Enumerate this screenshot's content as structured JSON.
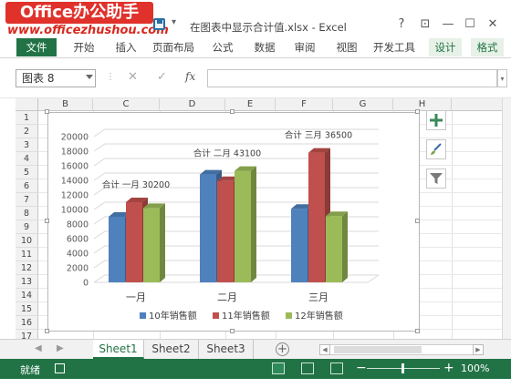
{
  "logo": {
    "brand": "Office办公助手",
    "url": "www.officezhushou.com"
  },
  "window": {
    "title": "在图表中显示合计值.xlsx - Excel",
    "help": "?",
    "restore_ribbon": "⊡",
    "minimize": "—",
    "maximize": "☐",
    "close": "✕"
  },
  "ribbon": {
    "tabs": [
      "文件",
      "开始",
      "插入",
      "页面布局",
      "公式",
      "数据",
      "审阅",
      "视图",
      "开发工具",
      "设计",
      "格式"
    ]
  },
  "formula_bar": {
    "name_box": "图表 8",
    "fx": "fx",
    "value": ""
  },
  "grid": {
    "columns": [
      "B",
      "C",
      "D",
      "E",
      "F",
      "G",
      "H"
    ],
    "rows": [
      "1",
      "2",
      "3",
      "4",
      "5",
      "6",
      "7",
      "8",
      "9",
      "10",
      "11",
      "12",
      "13",
      "14",
      "15",
      "16",
      "17"
    ]
  },
  "chart_data": {
    "type": "bar",
    "style": "3d-clustered-column",
    "categories": [
      "一月",
      "二月",
      "三月"
    ],
    "series": [
      {
        "name": "10年销售额",
        "color": "#4f81bd",
        "values": [
          9000,
          14800,
          10100
        ]
      },
      {
        "name": "11年销售额",
        "color": "#c0504d",
        "values": [
          11000,
          13900,
          17800
        ]
      },
      {
        "name": "12年销售额",
        "color": "#9bbb59",
        "values": [
          10200,
          15300,
          9100
        ]
      }
    ],
    "yticks": [
      "20000",
      "18000",
      "16000",
      "14000",
      "12000",
      "10000",
      "8000",
      "6000",
      "4000",
      "2000",
      "0"
    ],
    "ylim": [
      0,
      20000
    ],
    "grid": true,
    "legend": "bottom",
    "annotations": [
      "合计 一月 30200",
      "合计 二月 43100",
      "合计 三月 36500"
    ]
  },
  "chart_tools": {
    "add_element": "+",
    "styles": "brush",
    "filter": "filter"
  },
  "sheets": {
    "tabs": [
      "Sheet1",
      "Sheet2",
      "Sheet3"
    ],
    "active": 0,
    "add": "+"
  },
  "status": {
    "text": "就绪",
    "zoom_minus": "−",
    "zoom_plus": "+",
    "zoom_level": "100%"
  }
}
